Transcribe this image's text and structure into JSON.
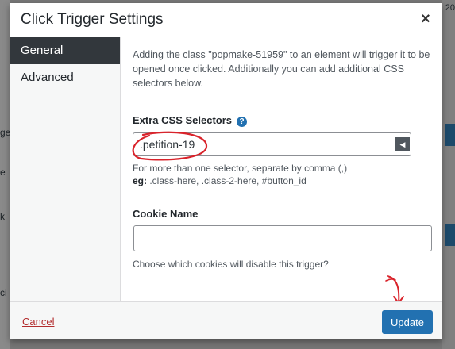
{
  "modal": {
    "title": "Click Trigger Settings",
    "close_glyph": "×"
  },
  "sidebar": {
    "tabs": [
      {
        "label": "General",
        "active": true
      },
      {
        "label": "Advanced",
        "active": false
      }
    ]
  },
  "general": {
    "description": "Adding the class \"popmake-51959\" to an element will trigger it to be opened once clicked. Additionally you can add additional CSS selectors below.",
    "extra_css": {
      "label": "Extra CSS Selectors",
      "help_glyph": "?",
      "value": ".petition-19",
      "toggle_glyph": "◀",
      "hint_line1": "For more than one selector, separate by comma (,)",
      "hint_eg_label": "eg:",
      "hint_eg_text": " .class-here, .class-2-here, #button_id"
    },
    "cookie": {
      "label": "Cookie Name",
      "value": "",
      "hint": "Choose which cookies will disable this trigger?"
    }
  },
  "footer": {
    "cancel_label": "Cancel",
    "update_label": "Update"
  },
  "colors": {
    "primary": "#2271b1",
    "cancel": "#b32d2e",
    "annotation": "#d9232b",
    "active_tab": "#32373c"
  },
  "background_fragments": [
    "ge",
    "e",
    "k",
    "20",
    "ci"
  ]
}
